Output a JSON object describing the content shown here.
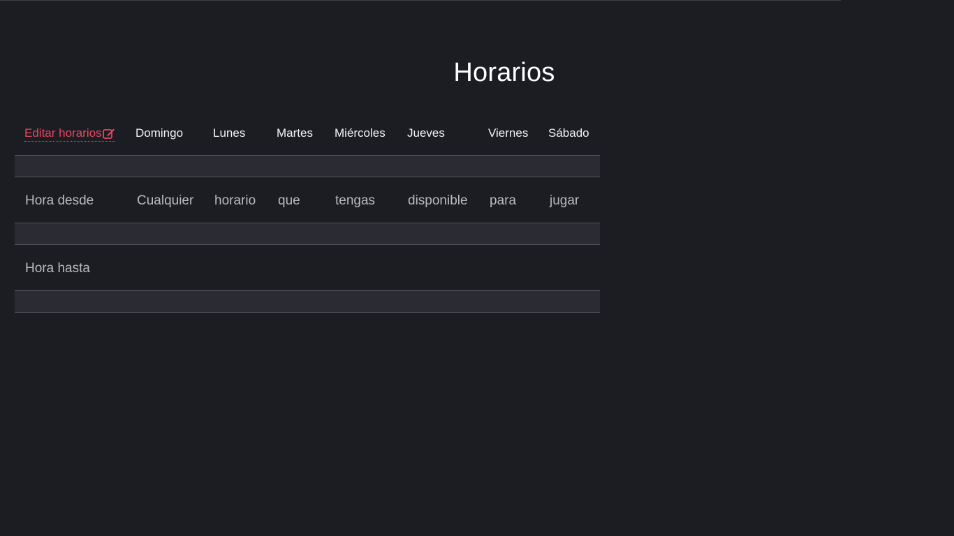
{
  "page": {
    "title": "Horarios"
  },
  "theme": {
    "background": "#1c1c23",
    "accent": "#e8475f",
    "band": "#2b2b33"
  },
  "schedule": {
    "edit_label": "Editar horarios",
    "edit_icon": "edit-square-icon",
    "days": [
      "Domingo",
      "Lunes",
      "Martes",
      "Miércoles",
      "Jueves",
      "Viernes",
      "Sábado"
    ],
    "rows": [
      {
        "label": "Hora desde",
        "values": [
          "Cualquier",
          "horario",
          "que",
          "tengas",
          "disponible",
          "para",
          "jugar"
        ]
      },
      {
        "label": "Hora hasta",
        "values": [
          "",
          "",
          "",
          "",
          "",
          "",
          ""
        ]
      }
    ]
  }
}
